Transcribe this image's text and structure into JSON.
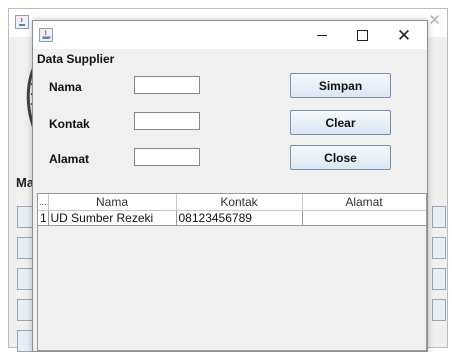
{
  "background_window": {
    "heading": "Ma"
  },
  "dialog": {
    "title": "",
    "section_title": "Data Supplier",
    "fields": [
      {
        "label": "Nama",
        "value": "",
        "placeholder": ""
      },
      {
        "label": "Kontak",
        "value": "",
        "placeholder": ""
      },
      {
        "label": "Alamat",
        "value": "",
        "placeholder": ""
      }
    ],
    "buttons": {
      "save_label": "Simpan",
      "clear_label": "Clear",
      "close_label": "Close"
    },
    "table": {
      "columns": [
        "...",
        "Nama",
        "Kontak",
        "Alamat"
      ],
      "rows": [
        [
          "1",
          "UD Sumber Rezeki",
          "08123456789",
          ""
        ]
      ]
    }
  },
  "icons": {
    "app": "java-cup-icon",
    "minimize": "minimize-icon",
    "maximize": "maximize-icon",
    "close": "close-icon"
  },
  "colors": {
    "button_border": "#7a8fa8",
    "button_top": "#f6f9fd",
    "button_bottom": "#dbe6f3",
    "window_bg": "#f0f0f0"
  }
}
